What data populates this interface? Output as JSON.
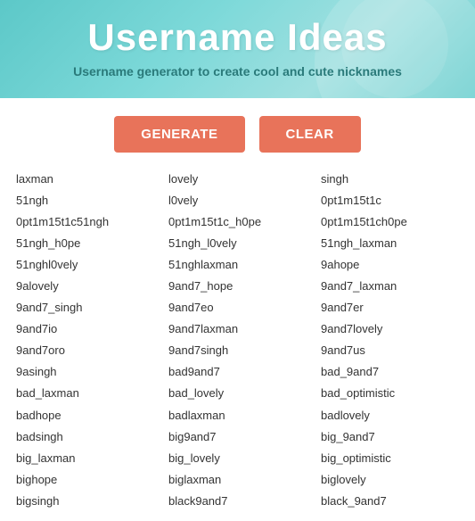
{
  "header": {
    "title": "Username Ideas",
    "subtitle": "Username generator to create cool and cute nicknames"
  },
  "buttons": {
    "generate": "GENERATE",
    "clear": "CLEAR"
  },
  "columns": [
    {
      "items": [
        "laxman",
        "51ngh",
        "0pt1m15t1c51ngh",
        "51ngh_h0pe",
        "51nghl0vely",
        "9alovely",
        "9and7_singh",
        "9and7io",
        "9and7oro",
        "9asingh",
        "bad_laxman",
        "badhope",
        "badsingh",
        "big_laxman",
        "bighope",
        "bigsingh"
      ]
    },
    {
      "items": [
        "lovely",
        "l0vely",
        "0pt1m15t1c_h0pe",
        "51ngh_l0vely",
        "51nghlaxman",
        "9and7_hope",
        "9and7eo",
        "9and7laxman",
        "9and7singh",
        "bad9and7",
        "bad_lovely",
        "badlaxman",
        "big9and7",
        "big_lovely",
        "biglaxman",
        "black9and7"
      ]
    },
    {
      "items": [
        "singh",
        "0pt1m15t1c",
        "0pt1m15t1ch0pe",
        "51ngh_laxman",
        "9ahope",
        "9and7_laxman",
        "9and7er",
        "9and7lovely",
        "9and7us",
        "bad_9and7",
        "bad_optimistic",
        "badlovely",
        "big_9and7",
        "big_optimistic",
        "biglovely",
        "black_9and7"
      ]
    }
  ]
}
